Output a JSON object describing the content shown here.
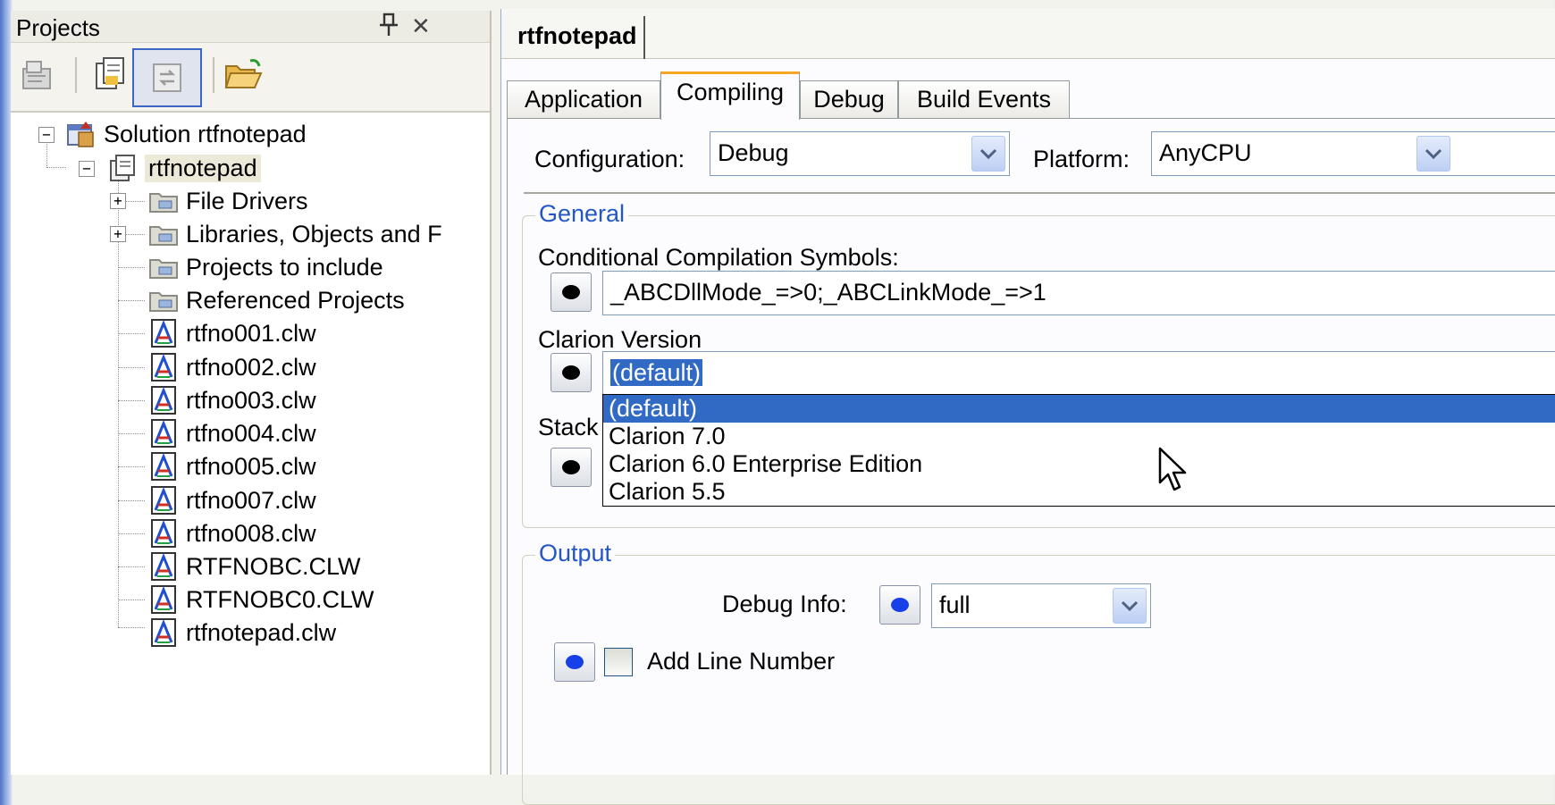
{
  "projects_panel": {
    "title": "Projects",
    "pin_glyph": "⌘",
    "close_glyph": "✕",
    "toolbar": [
      {
        "icon": "properties-icon"
      },
      {
        "icon": "show-all-files-icon"
      },
      {
        "icon": "refresh-icon"
      },
      {
        "icon": "open-folder-icon"
      }
    ],
    "tree": [
      {
        "label": "Solution rtfnotepad",
        "icon": "solution-icon",
        "expander": "−"
      },
      {
        "label": "rtfnotepad",
        "icon": "project-icon",
        "expander": "−"
      },
      {
        "label": "File Drivers",
        "icon": "folder-icon",
        "expander": "+"
      },
      {
        "label": "Libraries, Objects and F",
        "icon": "folder-icon",
        "expander": "+"
      },
      {
        "label": "Projects to include",
        "icon": "folder-icon"
      },
      {
        "label": "Referenced Projects",
        "icon": "folder-icon"
      },
      {
        "label": "rtfno001.clw",
        "icon": "clarion-file-icon"
      },
      {
        "label": "rtfno002.clw",
        "icon": "clarion-file-icon"
      },
      {
        "label": "rtfno003.clw",
        "icon": "clarion-file-icon"
      },
      {
        "label": "rtfno004.clw",
        "icon": "clarion-file-icon"
      },
      {
        "label": "rtfno005.clw",
        "icon": "clarion-file-icon"
      },
      {
        "label": "rtfno007.clw",
        "icon": "clarion-file-icon"
      },
      {
        "label": "rtfno008.clw",
        "icon": "clarion-file-icon"
      },
      {
        "label": "RTFNOBC.CLW",
        "icon": "clarion-file-icon"
      },
      {
        "label": "RTFNOBC0.CLW",
        "icon": "clarion-file-icon"
      },
      {
        "label": "rtfnotepad.clw",
        "icon": "clarion-file-icon"
      }
    ]
  },
  "editor": {
    "document_tab": "rtfnotepad",
    "tabs": [
      "Application",
      "Compiling",
      "Debug",
      "Build Events"
    ],
    "active_tab": "Compiling",
    "configuration_label": "Configuration:",
    "configuration_value": "Debug",
    "platform_label": "Platform:",
    "platform_value": "AnyCPU",
    "general": {
      "title": "General",
      "symbols_label": "Conditional Compilation Symbols:",
      "symbols_value": "_ABCDllMode_=>0;_ABCLinkMode_=>1",
      "version_label": "Clarion Version",
      "version_value": "(default)",
      "version_options": [
        "(default)",
        "Clarion 7.0",
        "Clarion 6.0  Enterprise Edition",
        "Clarion 5.5"
      ],
      "stack_label": "Stack"
    },
    "output": {
      "title": "Output",
      "debug_info_label": "Debug Info:",
      "debug_info_value": "full",
      "add_line_number_label": "Add Line Number",
      "add_line_number_checked": false
    }
  },
  "colors": {
    "accent_blue": "#316ac5",
    "group_title": "#2457c5",
    "active_tab_top": "#f5a623"
  }
}
